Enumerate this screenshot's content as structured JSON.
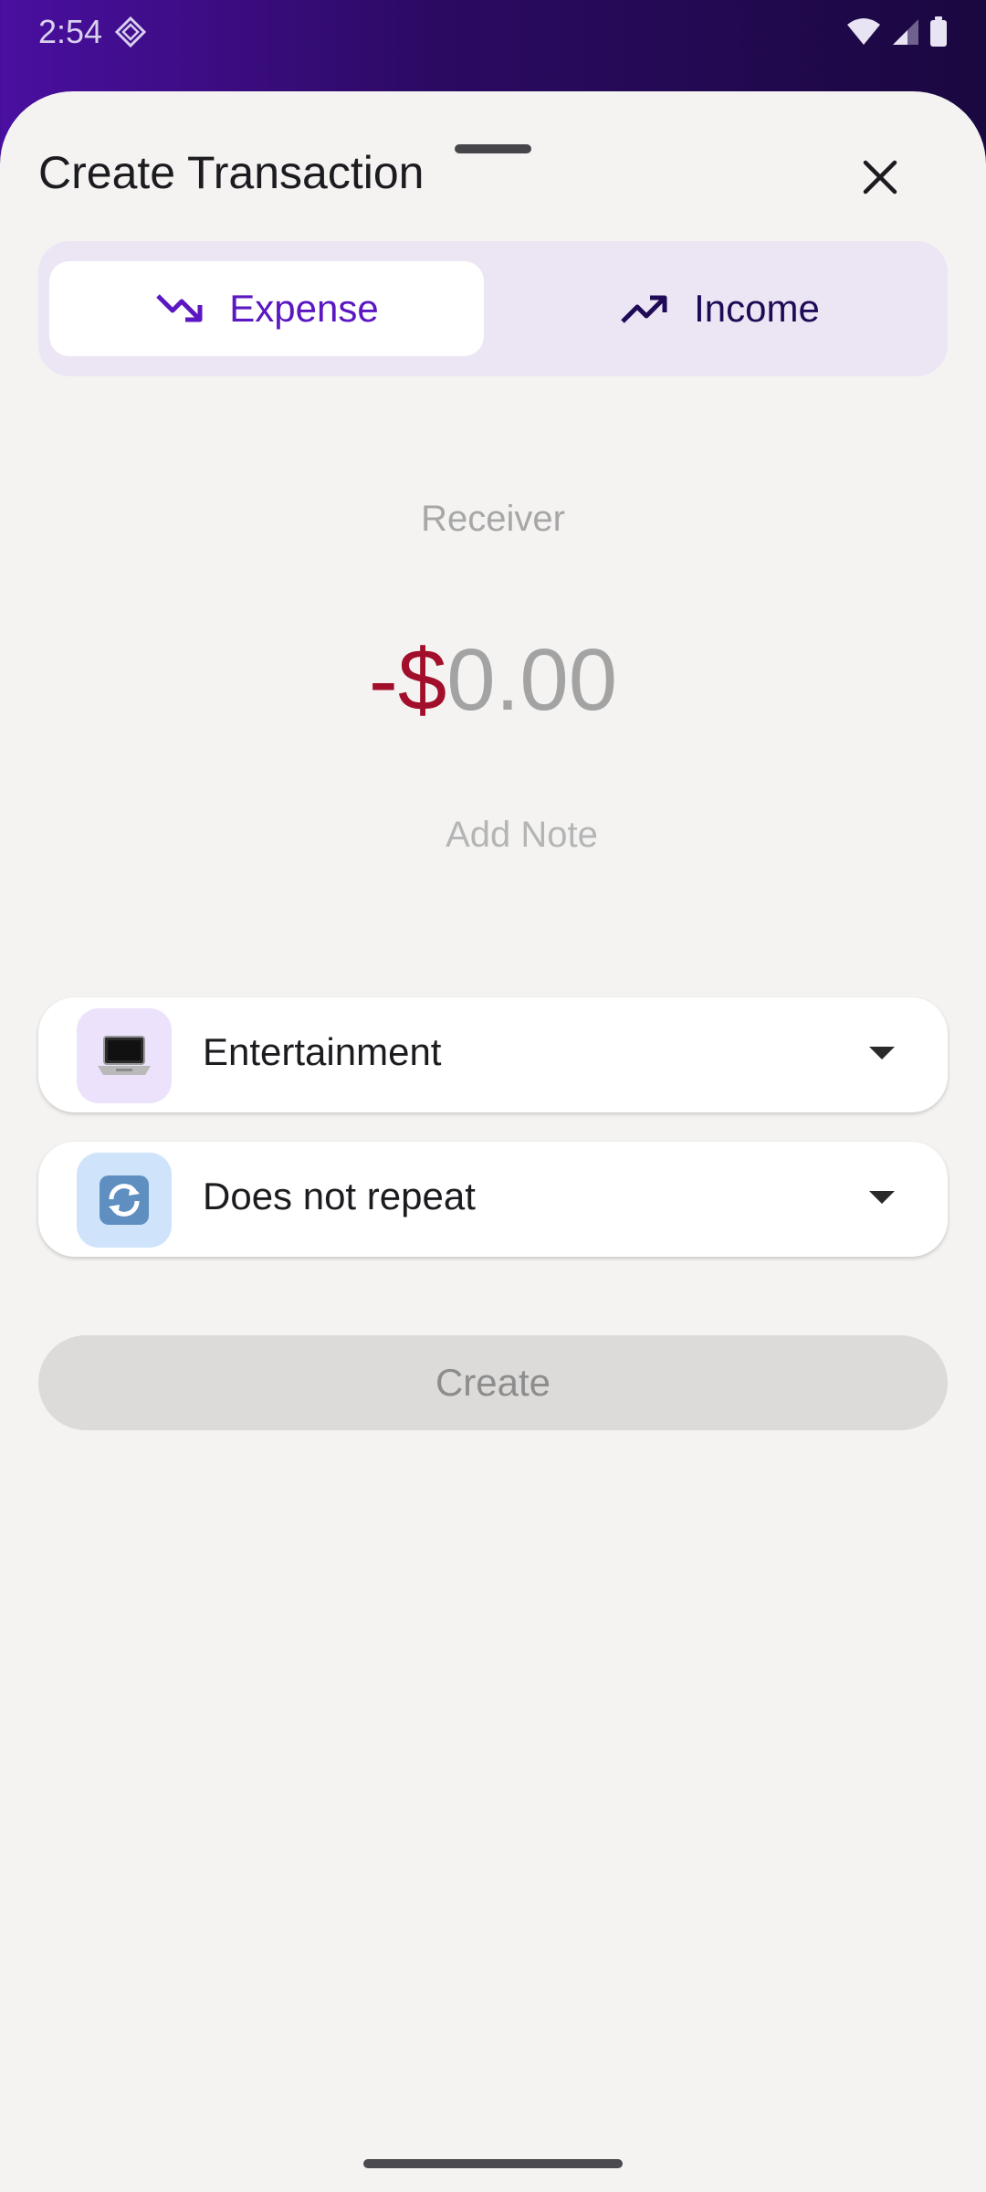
{
  "status_bar": {
    "time": "2:54",
    "icons": [
      "app-icon",
      "wifi-icon",
      "signal-icon",
      "battery-icon"
    ]
  },
  "sheet": {
    "title": "Create Transaction",
    "close_icon": "close-icon"
  },
  "type_toggle": {
    "expense_label": "Expense",
    "income_label": "Income",
    "selected": "Expense"
  },
  "receiver_placeholder": "Receiver",
  "amount": {
    "sign": "-$",
    "value": "0.00"
  },
  "note_placeholder": "Add Note",
  "category": {
    "label": "Entertainment",
    "icon": "laptop-icon"
  },
  "repeat": {
    "label": "Does not repeat",
    "icon": "repeat-icon"
  },
  "create_button": "Create",
  "colors": {
    "accent": "#5a17c2",
    "expense_red": "#a20f2a",
    "toggle_bg": "#ece5f3"
  }
}
